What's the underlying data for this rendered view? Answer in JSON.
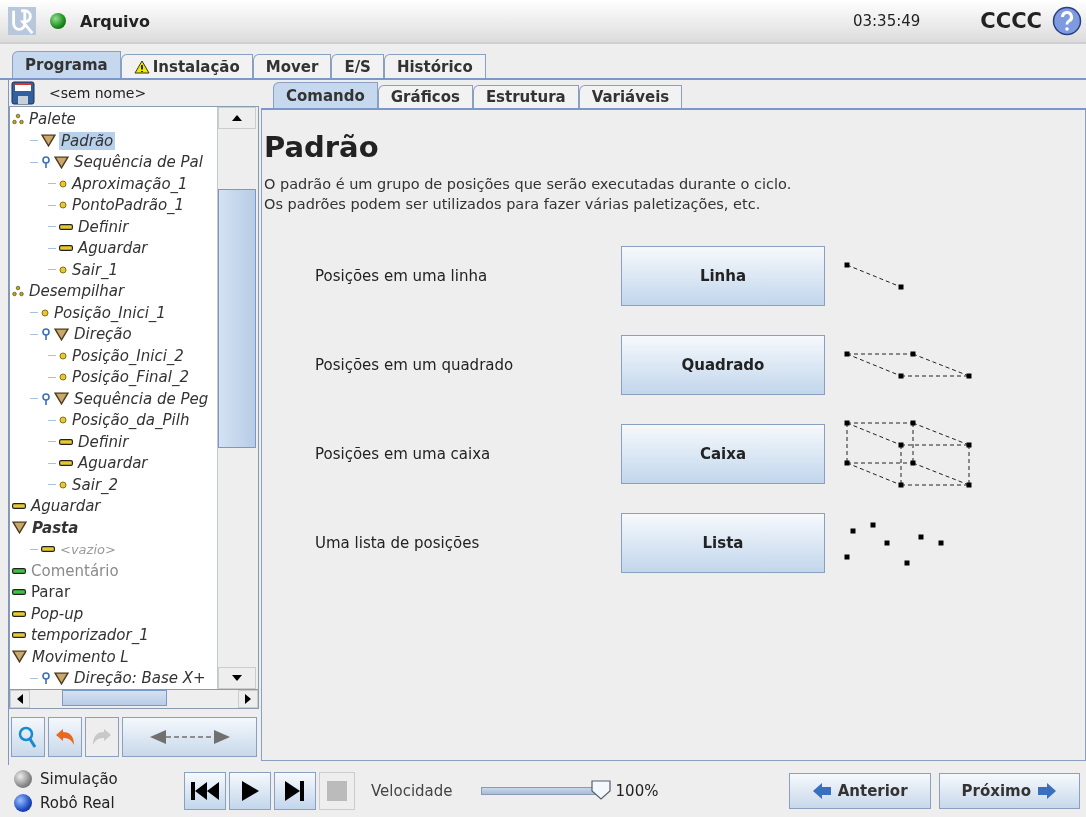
{
  "header": {
    "menu": "Arquivo",
    "time": "03:35:49",
    "robot_name": "CCCC"
  },
  "main_tabs": [
    {
      "label": "Programa",
      "selected": true,
      "warning": false
    },
    {
      "label": "Instalação",
      "selected": false,
      "warning": true
    },
    {
      "label": "Mover",
      "selected": false,
      "warning": false
    },
    {
      "label": "E/S",
      "selected": false,
      "warning": false
    },
    {
      "label": "Histórico",
      "selected": false,
      "warning": false
    }
  ],
  "program_name": "<sem nome>",
  "tree": [
    {
      "label": "Palete",
      "kind": "pallet",
      "defined": false,
      "selected": false,
      "children": [
        {
          "label": "Padrão",
          "kind": "triangle",
          "defined": false,
          "selected": true
        },
        {
          "label": "Sequência de Pal",
          "kind": "triangle",
          "defined": false,
          "selected": false,
          "expanded": true,
          "children": [
            {
              "label": "Aproximação_1",
              "kind": "point",
              "defined": false,
              "selected": false
            },
            {
              "label": "PontoPadrão_1",
              "kind": "point",
              "defined": false,
              "selected": false
            },
            {
              "label": "Definir",
              "kind": "bar",
              "defined": false,
              "selected": false
            },
            {
              "label": "Aguardar",
              "kind": "bar",
              "defined": false,
              "selected": false
            },
            {
              "label": "Sair_1",
              "kind": "point",
              "defined": false,
              "selected": false
            }
          ]
        }
      ]
    },
    {
      "label": "Desempilhar",
      "kind": "pallet",
      "defined": false,
      "selected": false,
      "children": [
        {
          "label": "Posição_Inici_1",
          "kind": "point",
          "defined": false,
          "selected": false
        },
        {
          "label": "Direção",
          "kind": "triangle",
          "defined": false,
          "selected": false,
          "expanded": true,
          "children": [
            {
              "label": "Posição_Inici_2",
              "kind": "point",
              "defined": false,
              "selected": false
            },
            {
              "label": "Posição_Final_2",
              "kind": "point",
              "defined": false,
              "selected": false
            }
          ]
        },
        {
          "label": "Sequência de Peg",
          "kind": "triangle",
          "defined": false,
          "selected": false,
          "expanded": true,
          "children": [
            {
              "label": "Posição_da_Pilh",
              "kind": "point",
              "defined": false,
              "selected": false
            },
            {
              "label": "Definir",
              "kind": "bar",
              "defined": false,
              "selected": false
            },
            {
              "label": "Aguardar",
              "kind": "bar",
              "defined": false,
              "selected": false
            },
            {
              "label": "Sair_2",
              "kind": "point",
              "defined": false,
              "selected": false
            }
          ]
        }
      ]
    },
    {
      "label": "Aguardar",
      "kind": "bar",
      "defined": false,
      "selected": false
    },
    {
      "label": "Pasta",
      "kind": "folder",
      "defined": false,
      "selected": false,
      "children": [
        {
          "label": "<vazio>",
          "kind": "placeholder",
          "defined": false,
          "selected": false
        }
      ]
    },
    {
      "label": "Comentário",
      "kind": "comment",
      "defined": true,
      "selected": false
    },
    {
      "label": "Parar",
      "kind": "bar",
      "defined": true,
      "selected": false
    },
    {
      "label": "Pop-up",
      "kind": "bar",
      "defined": false,
      "selected": false
    },
    {
      "label": "temporizador_1",
      "kind": "bar",
      "defined": false,
      "selected": false
    },
    {
      "label": "Movimento L",
      "kind": "triangle",
      "defined": false,
      "selected": false,
      "children": [
        {
          "label": "Direção: Base X+",
          "kind": "triangle",
          "defined": false,
          "selected": false,
          "expanded": true
        }
      ]
    }
  ],
  "sub_tabs": [
    {
      "label": "Comando",
      "selected": true
    },
    {
      "label": "Gráficos",
      "selected": false
    },
    {
      "label": "Estrutura",
      "selected": false
    },
    {
      "label": "Variáveis",
      "selected": false
    }
  ],
  "panel": {
    "title": "Padrão",
    "description": [
      "O padrão é um grupo de posições que serão executadas durante o ciclo.",
      "Os padrões podem ser utilizados para fazer várias paletizações, etc."
    ],
    "options": [
      {
        "label": "Posições em uma linha",
        "button": "Linha",
        "kind": "line"
      },
      {
        "label": "Posições em um quadrado",
        "button": "Quadrado",
        "kind": "square"
      },
      {
        "label": "Posições em uma caixa",
        "button": "Caixa",
        "kind": "box"
      },
      {
        "label": "Uma lista de posições",
        "button": "Lista",
        "kind": "list"
      }
    ]
  },
  "modes": [
    {
      "label": "Simulação",
      "selected": false
    },
    {
      "label": "Robô Real",
      "selected": true
    }
  ],
  "speed": {
    "label": "Velocidade",
    "level": 1.0,
    "reading": "100%"
  },
  "nav": {
    "back": "Anterior",
    "next": "Próximo"
  }
}
